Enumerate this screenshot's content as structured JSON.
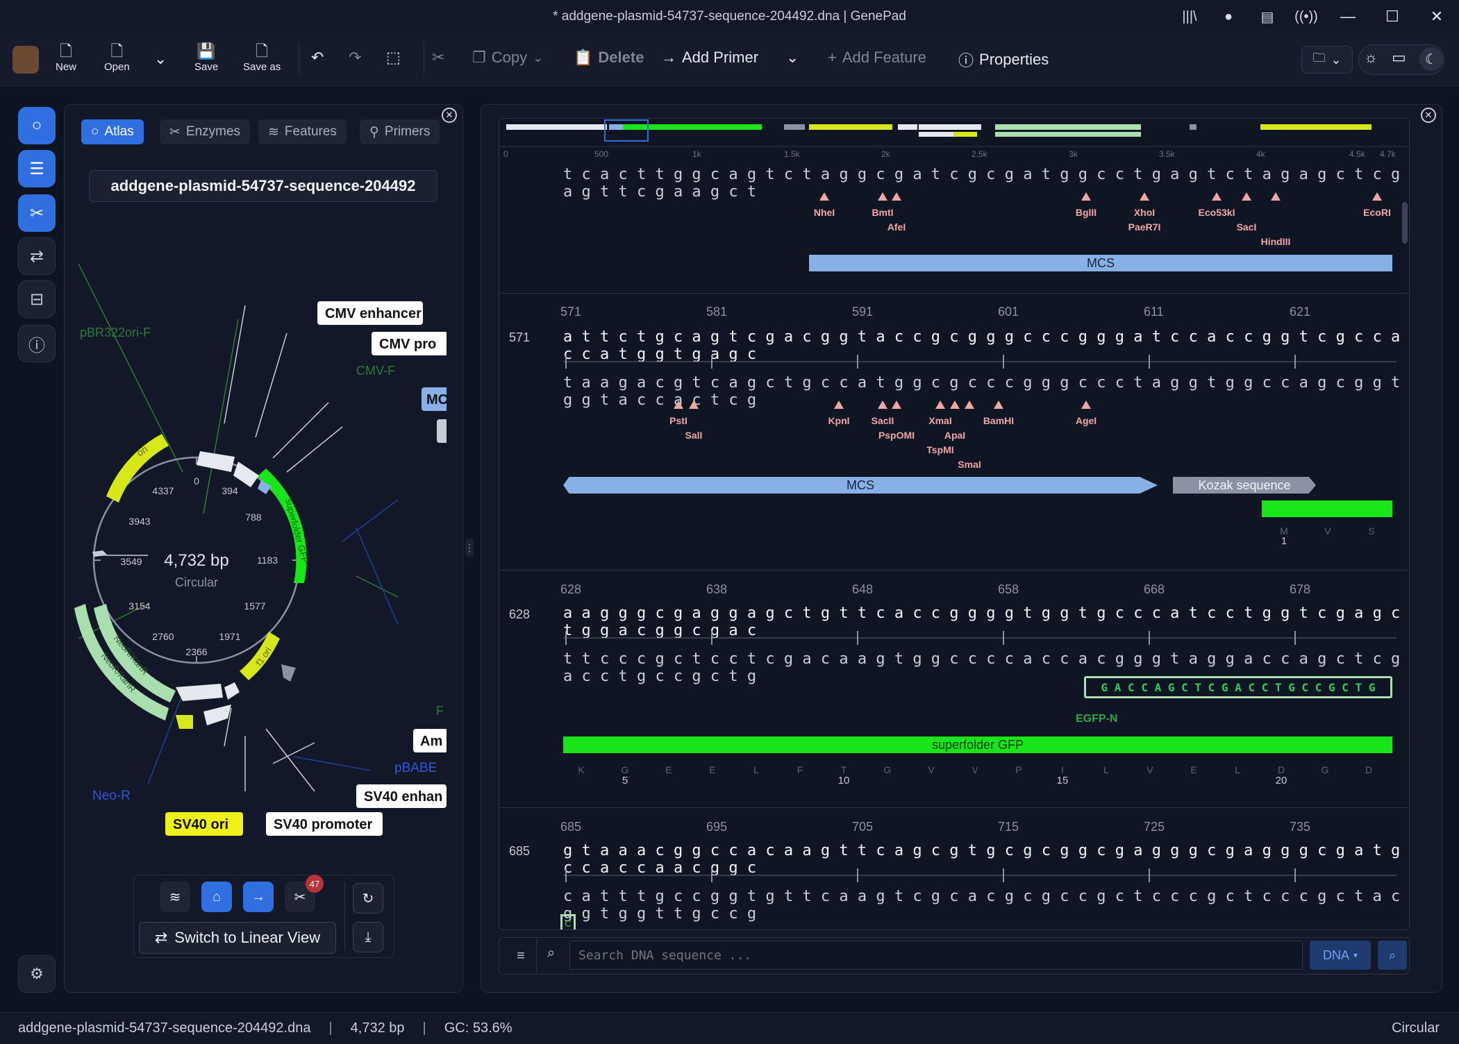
{
  "window": {
    "title": "* addgene-plasmid-54737-sequence-204492.dna | GenePad"
  },
  "toolbar": {
    "new": "New",
    "open": "Open",
    "save": "Save",
    "save_as": "Save as",
    "copy": "Copy",
    "delete": "Delete",
    "add_primer": "Add Primer",
    "add_feature": "Add Feature",
    "properties": "Properties"
  },
  "left": {
    "tabs": [
      "Atlas",
      "Enzymes",
      "Features",
      "Primers"
    ],
    "sequence_name": "addgene-plasmid-54737-sequence-204492",
    "map": {
      "length": "4,732 bp",
      "topology": "Circular",
      "ticks": [
        "0",
        "394",
        "788",
        "1183",
        "1577",
        "1971",
        "2366",
        "2760",
        "3154",
        "3549",
        "3943",
        "4337"
      ],
      "labels": {
        "cmv_enhancer": "CMV enhancer",
        "cmv_pro": "CMV pro",
        "cmv_f": "CMV-F",
        "mc": "MC",
        "pbr322": "pBR322ori-F",
        "ori": "ori",
        "sfgfp": "superfolder GFP",
        "f1": "f1 ori",
        "neo1": "NeoR/KanR",
        "neo2": "NeoR/KanR",
        "neo_r": "Neo-R",
        "sv40ori": "SV40 ori",
        "sv40prom": "SV40 promoter",
        "sv40enh": "SV40 enhan",
        "pbabe": "pBABE",
        "am": "Am",
        "f": "F"
      }
    },
    "badge": "47",
    "switch_view": "Switch to Linear View"
  },
  "overview": {
    "axis": [
      "0",
      "500",
      "1k",
      "1.5k",
      "2k",
      "2.5k",
      "3k",
      "3.5k",
      "4k",
      "4.5k",
      "4.7k"
    ]
  },
  "blocks": [
    {
      "start": "",
      "ticks": [],
      "top": "",
      "bottom": "t c a c t t g g c a g t c t a g g c g a t c g c g a t g g c c t g a g t c t a g a g c t c g a g t t c g a a g c t",
      "enzymes": [
        "NheI",
        "BmtI",
        "AfeI",
        "BglII",
        "XhoI",
        "PaeR7I",
        "Eco53kI",
        "SacI",
        "HindIII",
        "EcoRI"
      ],
      "feature": "MCS"
    },
    {
      "start": "571",
      "ticks": [
        "571",
        "581",
        "591",
        "601",
        "611",
        "621"
      ],
      "top": "a t t c t g c a g t c g a c g g t a c c g c g g g c c c g g g a t c c a c c g g t c g c c a c c a t g g t g a g c",
      "bottom": "t a a g a c g t c a g c t g c c a t g g c g c c c g g g c c c t a g g t g g c c a g c g g t g g t a c c a c t c g",
      "enzymes": [
        "PstI",
        "SalI",
        "KpnI",
        "SacII",
        "PspOMI",
        "XmaI",
        "ApaI",
        "TspMI",
        "SmaI",
        "BamHI",
        "AgeI"
      ],
      "features": [
        "MCS",
        "Kozak sequence"
      ],
      "aa": [
        "M",
        "V",
        "S"
      ],
      "aanum": "1"
    },
    {
      "start": "628",
      "ticks": [
        "628",
        "638",
        "648",
        "658",
        "668",
        "678"
      ],
      "top": "a a g g g c g a g g a g c t g t t c a c c g g g g t g g t g c c c a t c c t g g t c g a g c t g g a c g g c g a c",
      "bottom": "t t c c c g c t c c t c g a c a a g t g g c c c c a c c a c g g g t a g g a c c a g c t c g a c c t g c c g c t g",
      "primer_seq": "G A C C A G C T C G A C C T G C C G C T G",
      "primer_name": "EGFP-N",
      "feature": "superfolder GFP",
      "aa": [
        "K",
        "G",
        "E",
        "E",
        "L",
        "F",
        "T",
        "G",
        "V",
        "V",
        "P",
        "I",
        "L",
        "V",
        "E",
        "L",
        "D",
        "G",
        "D"
      ],
      "aanums": [
        "5",
        "10",
        "15",
        "20"
      ]
    },
    {
      "start": "685",
      "ticks": [
        "685",
        "695",
        "705",
        "715",
        "725",
        "735"
      ],
      "top": "g t a a a c g g c c a c a a g t t c a g c g t g c g c g g c g a g g g c g a g g g c g a t g c c a c c a a c g g c",
      "bottom": "c a t t t g c c g g t g t t c a a g t c g c a c g c g c c g c t c c c g c t c c c g c t a c g g t g g t t g c c g",
      "cursor": "C"
    }
  ],
  "search": {
    "placeholder": "Search DNA sequence ...",
    "mode": "DNA"
  },
  "status": {
    "file": "addgene-plasmid-54737-sequence-204492.dna",
    "length": "4,732 bp",
    "gc": "GC: 53.6%",
    "topology": "Circular"
  },
  "colors": {
    "accent": "#2f6fe0",
    "gfp": "#19e619",
    "mcs": "#86b0e6",
    "enzyme": "#f0a6a6",
    "ori": "#d6e81a",
    "neo": "#a9dfae"
  }
}
